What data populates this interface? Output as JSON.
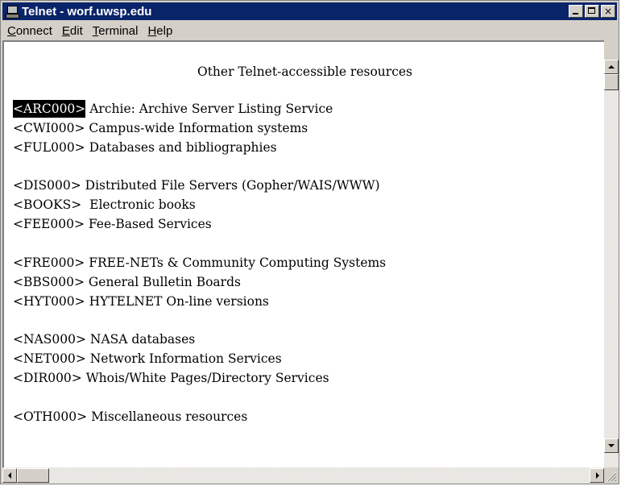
{
  "window": {
    "title": "Telnet - worf.uwsp.edu",
    "icon": "telnet-terminal-icon",
    "controls": {
      "minimize": "minimize-icon",
      "maximize": "maximize-icon",
      "close": "×"
    }
  },
  "menu": [
    {
      "label": "Connect",
      "accel": "C",
      "rest": "onnect"
    },
    {
      "label": "Edit",
      "accel": "E",
      "rest": "dit"
    },
    {
      "label": "Terminal",
      "accel": "T",
      "rest": "erminal"
    },
    {
      "label": "Help",
      "accel": "H",
      "rest": "elp"
    }
  ],
  "terminal": {
    "heading": "Other Telnet-accessible resources",
    "selected_code": "<ARC000>",
    "entries": [
      {
        "code": "<ARC000>",
        "gap": " ",
        "text": "Archie: Archive Server Listing Service"
      },
      {
        "code": "<CWI000>",
        "gap": " ",
        "text": "Campus-wide Information systems"
      },
      {
        "code": "<FUL000>",
        "gap": " ",
        "text": "Databases and bibliographies"
      },
      {
        "code": "<DIS000>",
        "gap": " ",
        "text": "Distributed File Servers (Gopher/WAIS/WWW)"
      },
      {
        "code": "<BOOKS>",
        "gap": "  ",
        "text": "Electronic books"
      },
      {
        "code": "<FEE000>",
        "gap": " ",
        "text": "Fee-Based Services"
      },
      {
        "code": "<FRE000>",
        "gap": " ",
        "text": "FREE-NETs & Community Computing Systems"
      },
      {
        "code": "<BBS000>",
        "gap": " ",
        "text": "General Bulletin Boards"
      },
      {
        "code": "<HYT000>",
        "gap": " ",
        "text": "HYTELNET On-line versions"
      },
      {
        "code": "<NAS000>",
        "gap": " ",
        "text": "NASA databases"
      },
      {
        "code": "<NET000>",
        "gap": " ",
        "text": "Network Information Services"
      },
      {
        "code": "<DIR000>",
        "gap": " ",
        "text": "Whois/White Pages/Directory Services"
      },
      {
        "code": "<OTH000>",
        "gap": " ",
        "text": "Miscellaneous resources"
      }
    ]
  },
  "colors": {
    "titlebar": "#0a246a",
    "chrome": "#d4d0c8",
    "selection_bg": "#000000",
    "selection_fg": "#ffffff"
  }
}
